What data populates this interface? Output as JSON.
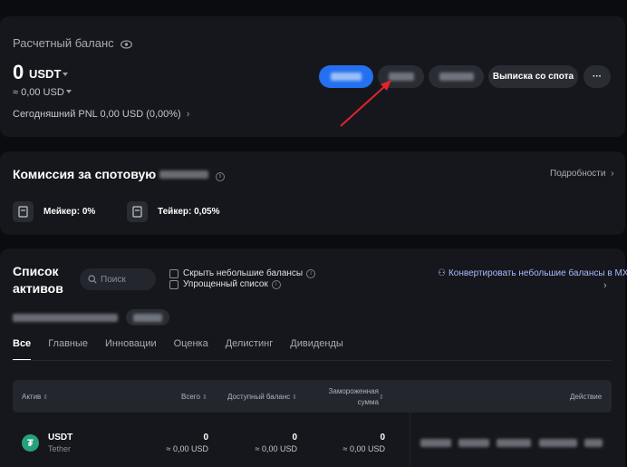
{
  "balance": {
    "title": "Расчетный баланс",
    "amount": "0",
    "currency": "USDT",
    "usd_approx": "≈ 0,00 USD",
    "pnl": "Сегодняшний PNL 0,00 USD (0,00%)",
    "buttons": {
      "statement": "Выписка со спота",
      "more": "···"
    }
  },
  "fee": {
    "title": "Комиссия за спотовую",
    "details": "Подробности",
    "maker": "Мейкер: 0%",
    "taker": "Тейкер: 0,05%"
  },
  "assets": {
    "title": "Список активов",
    "search_placeholder": "Поиск",
    "hide_small": "Скрыть небольшие балансы",
    "simple_list": "Упрощенный список",
    "convert": "Конвертировать небольшие балансы в MX",
    "tabs": [
      "Все",
      "Главные",
      "Инновации",
      "Оценка",
      "Делистинг",
      "Дивиденды"
    ],
    "active_tab": "Все",
    "columns": {
      "asset": "Актив",
      "total": "Всего",
      "available": "Доступный баланс",
      "frozen": "Замороженная сумма",
      "action": "Действие"
    },
    "rows": [
      {
        "symbol": "USDT",
        "name": "Tether",
        "total": "0",
        "total_usd": "≈ 0,00 USD",
        "available": "0",
        "available_usd": "≈ 0,00 USD",
        "frozen": "0",
        "frozen_usd": "≈ 0,00 USD"
      }
    ]
  },
  "colors": {
    "accent_blue": "#2370f0",
    "annotation_arrow": "#e0242b",
    "usdt_green": "#26a17b"
  }
}
